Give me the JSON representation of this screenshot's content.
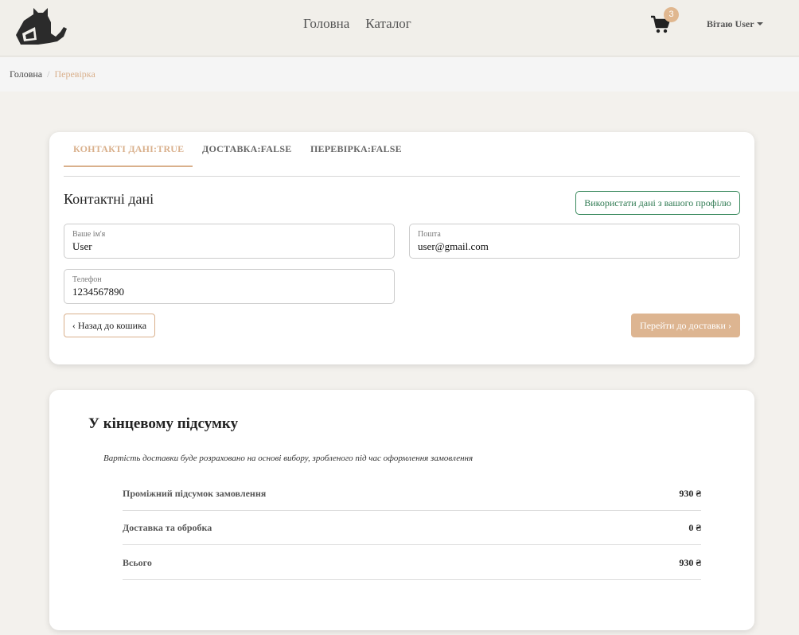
{
  "header": {
    "nav": [
      "Головна",
      "Каталог"
    ],
    "cart_count": "3",
    "user_greeting": "Вітаю User"
  },
  "breadcrumb": {
    "home": "Головна",
    "current": "Перевірка"
  },
  "checkout": {
    "tabs": [
      "КОНТАКТІ ДАНІ:TRUE",
      "ДОСТАВКА:FALSE",
      "ПЕРЕВІРКА:FALSE"
    ],
    "section_title": "Контактні дані",
    "use_profile_label": "Використати дані з вашого профілю",
    "fields": {
      "name": {
        "label": "Ваше ім'я",
        "value": "User"
      },
      "email": {
        "label": "Пошта",
        "value": "user@gmail.com"
      },
      "phone": {
        "label": "Телефон",
        "value": "1234567890"
      }
    },
    "back_label": "Назад до кошика",
    "next_label": "Перейти до доставки"
  },
  "summary": {
    "title": "У кінцевому підсумку",
    "note": "Вартість доставки буде розраховано на основі вибору, зробленого під час оформлення замовлення",
    "rows": [
      {
        "label": "Проміжний підсумок замовлення",
        "value": "930 ₴"
      },
      {
        "label": "Доставка та обробка",
        "value": "0 ₴"
      },
      {
        "label": "Всього",
        "value": "930 ₴"
      }
    ]
  },
  "colors": {
    "accent": "#d9b08c",
    "profile_button": "#3a8a5e",
    "header_bg": "#f1efea"
  }
}
